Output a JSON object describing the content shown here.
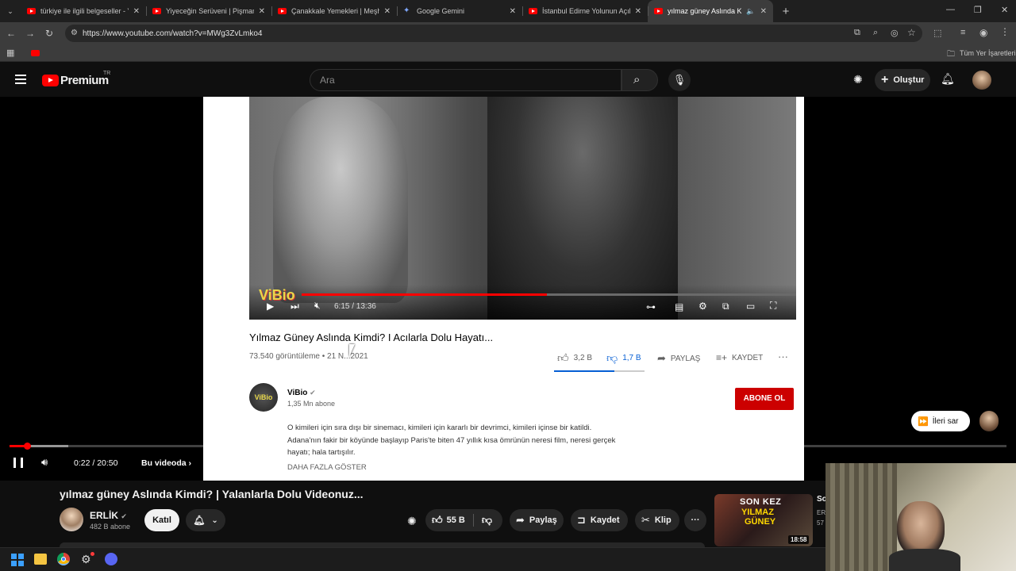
{
  "browser": {
    "tabs": [
      {
        "title": "türkiye ile ilgili belgeseller - You",
        "icon": "youtube-icon",
        "active": false
      },
      {
        "title": "Yiyeceğin Serüveni | Pişmaniye",
        "icon": "youtube-icon",
        "active": false
      },
      {
        "title": "Çanakkale Yemekleri | Meşhur T",
        "icon": "youtube-icon",
        "active": false
      },
      {
        "title": "Google Gemini",
        "icon": "gemini-icon",
        "active": false
      },
      {
        "title": "İstanbul Edirne Yolunun Açılış T",
        "icon": "youtube-icon",
        "active": false
      },
      {
        "title": "yılmaz güney Aslında Kimdi",
        "icon": "youtube-icon",
        "active": true
      }
    ],
    "url": "https://www.youtube.com/watch?v=MWg3ZvLmko4",
    "bookmarks_label": "Tüm Yer İşaretleri"
  },
  "youtube": {
    "logo": "Premium",
    "region": "TR",
    "search_placeholder": "Ara",
    "create_label": "Oluştur"
  },
  "inner_video": {
    "time": "6:15 / 13:36",
    "progress": 0.46,
    "title": "Yılmaz Güney Aslında Kimdi? I Acılarla Dolu Hayatı...",
    "meta": "73.540 görüntüleme • 21 N...2021",
    "likes": "3,2 B",
    "dislikes": "1,7 B",
    "share": "PAYLAŞ",
    "save": "KAYDET",
    "channel": "ViBio",
    "subscribers": "1,35 Mn abone",
    "subscribe": "ABONE OL",
    "desc_1": "O kimileri için sıra dışı bir sinemacı, kimileri için kararlı bir devrimci, kimileri içinse bir katildi.",
    "desc_2": "Adana'nın fakir bir köyünde başlayıp Paris'te biten 47 yıllık kısa ömrünün neresi film, neresi gerçek",
    "desc_3": "hayatı; hala tartışılır.",
    "show_more": "DAHA FAZLA GÖSTER",
    "watermark": "ViBio"
  },
  "player": {
    "time": "0:22 / 20:50",
    "progress": 0.0176,
    "chapter": "Bu videoda",
    "skip_label": "İleri sar"
  },
  "video": {
    "title": "yılmaz güney Aslında Kimdi? | Yalanlarla Dolu Videonuz...",
    "channel": "ERLİK",
    "subscribers": "482 B abone",
    "join": "Katıl",
    "likes": "55 B",
    "share": "Paylaş",
    "save": "Kaydet",
    "clip": "Klip"
  },
  "suggested": {
    "thumb_line1": "SON KEZ",
    "thumb_line2": "YILMAZ",
    "thumb_line3": "GÜNEY",
    "duration": "18:58",
    "title_fragment": "So",
    "channel_fragment": "ER",
    "meta_fragment": "57"
  },
  "colors": {
    "youtube_red": "#ff0000",
    "subscribe_red": "#cc0000",
    "accent_blue": "#065fd4"
  }
}
